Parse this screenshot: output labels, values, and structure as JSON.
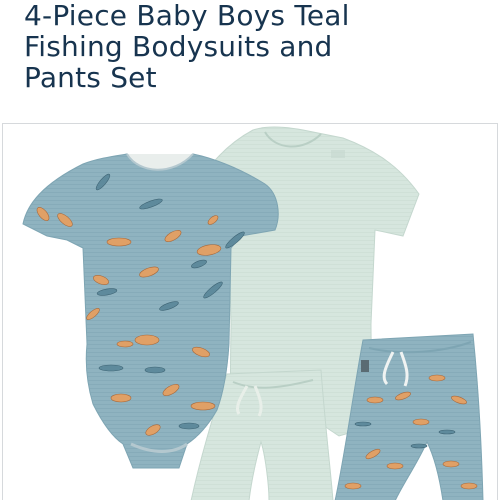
{
  "product": {
    "title_lines": [
      "4-Piece Baby Boys Teal",
      "Fishing Bodysuits and",
      "Pants Set"
    ]
  },
  "gallery": {
    "image_icon": "product-photo",
    "colors": {
      "teal": "#8fb3c0",
      "teal_dark": "#7ea5b3",
      "mint": "#d6e6de",
      "mint_shade": "#c4d7ce",
      "fish_orange": "#e0a066",
      "fish_blue": "#5e8a9c",
      "title": "#17344f"
    }
  }
}
